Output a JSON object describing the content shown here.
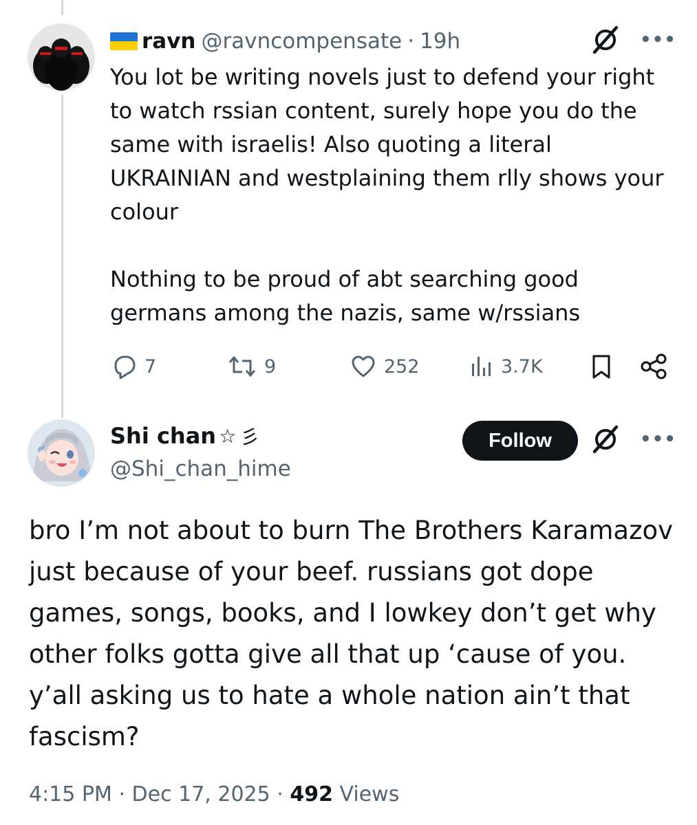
{
  "tweet1": {
    "name": "ravn",
    "handle": "@ravncompensate",
    "sep": "·",
    "time": "19h",
    "paragraph1": "You lot be writing novels just to defend your right to watch rssian content, surely hope you do the same with israelis! Also quoting a literal UKRAINIAN and westplaining them rlly shows your colour",
    "paragraph2": "Nothing to be proud of abt searching good germans among the nazis, same w/rssians",
    "replies": "7",
    "retweets": "9",
    "likes": "252",
    "views": "3.7K",
    "more": "•••"
  },
  "tweet2": {
    "name": "Shi chan",
    "star": "☆",
    "kana": "彡",
    "handle": "@Shi_chan_hime",
    "follow_label": "Follow",
    "more": "•••",
    "body": "bro I’m not about to burn The Brothers Karamazov just because of your beef. russians got dope games, songs, books, and I lowkey don’t get why other folks gotta give all that up ‘cause of you. y’all asking us to hate a whole nation ain’t that fascism?",
    "time": "4:15 PM",
    "sep": "·",
    "date": "Dec 17, 2025",
    "views_count": "492",
    "views_label": "Views"
  },
  "colors": {
    "text": "#0f1419",
    "secondary": "#536471",
    "thread_line": "#cfd9de",
    "follow_bg": "#0f1419",
    "flag_blue": "#1e74d6",
    "flag_yellow": "#ffcf00"
  },
  "icons": [
    "flag-ukraine-icon",
    "grok-icon",
    "more-icon",
    "reply-icon",
    "retweet-icon",
    "like-icon",
    "views-icon",
    "bookmark-icon",
    "share-icon"
  ]
}
